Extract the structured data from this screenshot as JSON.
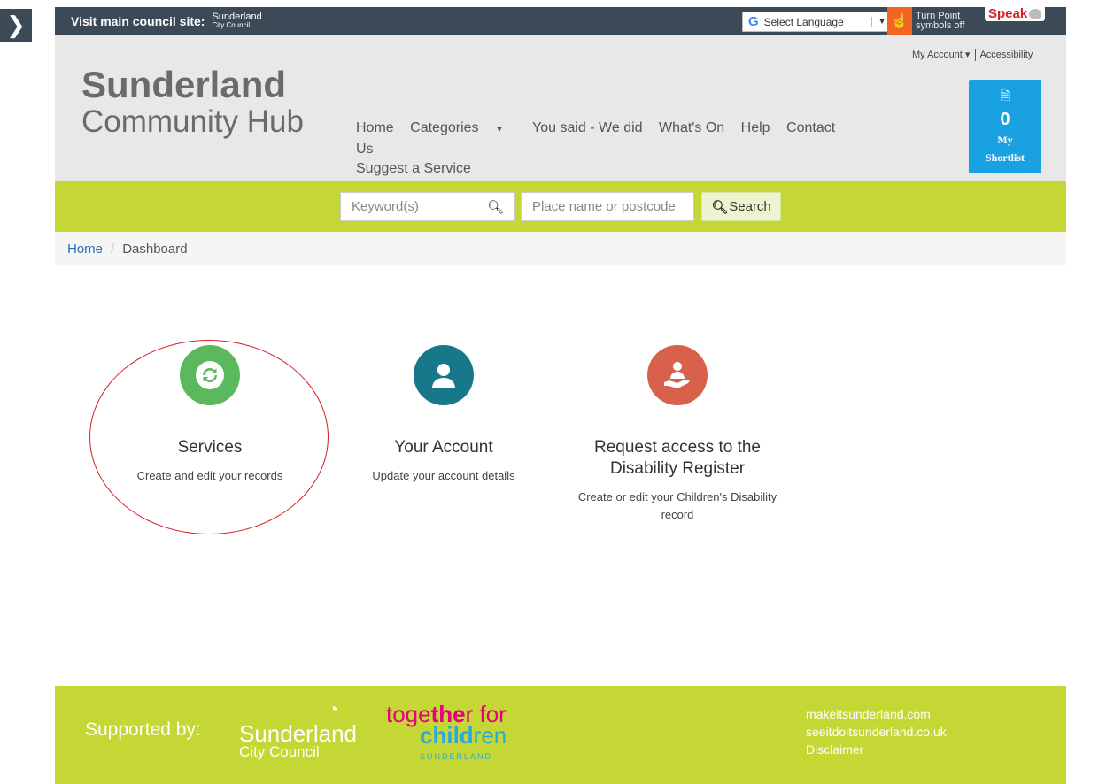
{
  "sidebar_toggle": {
    "glyph": "❯"
  },
  "topbar": {
    "visit_label": "Visit main council site:",
    "council_logo_line1": "Sunderland",
    "council_logo_line2": "City Council",
    "language_select": "Select Language",
    "language_arrow": "▼",
    "language_g": "G",
    "turn_point_line1": "Turn Point",
    "turn_point_line2": "symbols off",
    "speak_label": "Speak"
  },
  "header": {
    "brand_line1": "Sunderland",
    "brand_line2": "Community Hub",
    "my_account": "My Account",
    "accessibility": "Accessibility",
    "nav": [
      {
        "label": "Home"
      },
      {
        "label": "Categories"
      },
      {
        "label": "You said - We did"
      },
      {
        "label": "What's On"
      },
      {
        "label": "Help"
      },
      {
        "label": "Contact Us"
      },
      {
        "label": "Suggest a Service"
      }
    ],
    "shortlist_count": "0",
    "shortlist_label1": "My",
    "shortlist_label2": "Shortlist"
  },
  "search": {
    "keyword_placeholder": "Keyword(s)",
    "place_placeholder": "Place name or postcode",
    "button_label": "Search"
  },
  "breadcrumb": {
    "home": "Home",
    "current": "Dashboard"
  },
  "tiles": [
    {
      "title": "Services",
      "description": "Create and edit your records",
      "color": "#5cb85c",
      "icon": "refresh-icon"
    },
    {
      "title": "Your Account",
      "description": "Update your account details",
      "color": "#17788a",
      "icon": "user-icon"
    },
    {
      "title": "Request access to the Disability Register",
      "description": "Create or edit your Children's Disability record",
      "color": "#d9614c",
      "icon": "care-hand-icon"
    }
  ],
  "annotation_color": "#d51f26",
  "footer": {
    "supported_by": "Supported by:",
    "scc_line1": "Sunderland",
    "scc_line2": "City Council",
    "tfc_line1_a": "toge",
    "tfc_line1_b": "the",
    "tfc_line1_c": "r for",
    "tfc_line2_a": "child",
    "tfc_line2_b": "ren",
    "tfc_line3": "SUNDERLAND",
    "links": [
      {
        "label": "makeitsunderland.com"
      },
      {
        "label": "seeitdoitsunderland.co.uk"
      },
      {
        "label": "Disclaimer"
      }
    ]
  },
  "colors": {
    "topbar": "#3c4a58",
    "lime": "#c4d734",
    "shortlist": "#1aa1e1",
    "link": "#2a6fb0"
  }
}
